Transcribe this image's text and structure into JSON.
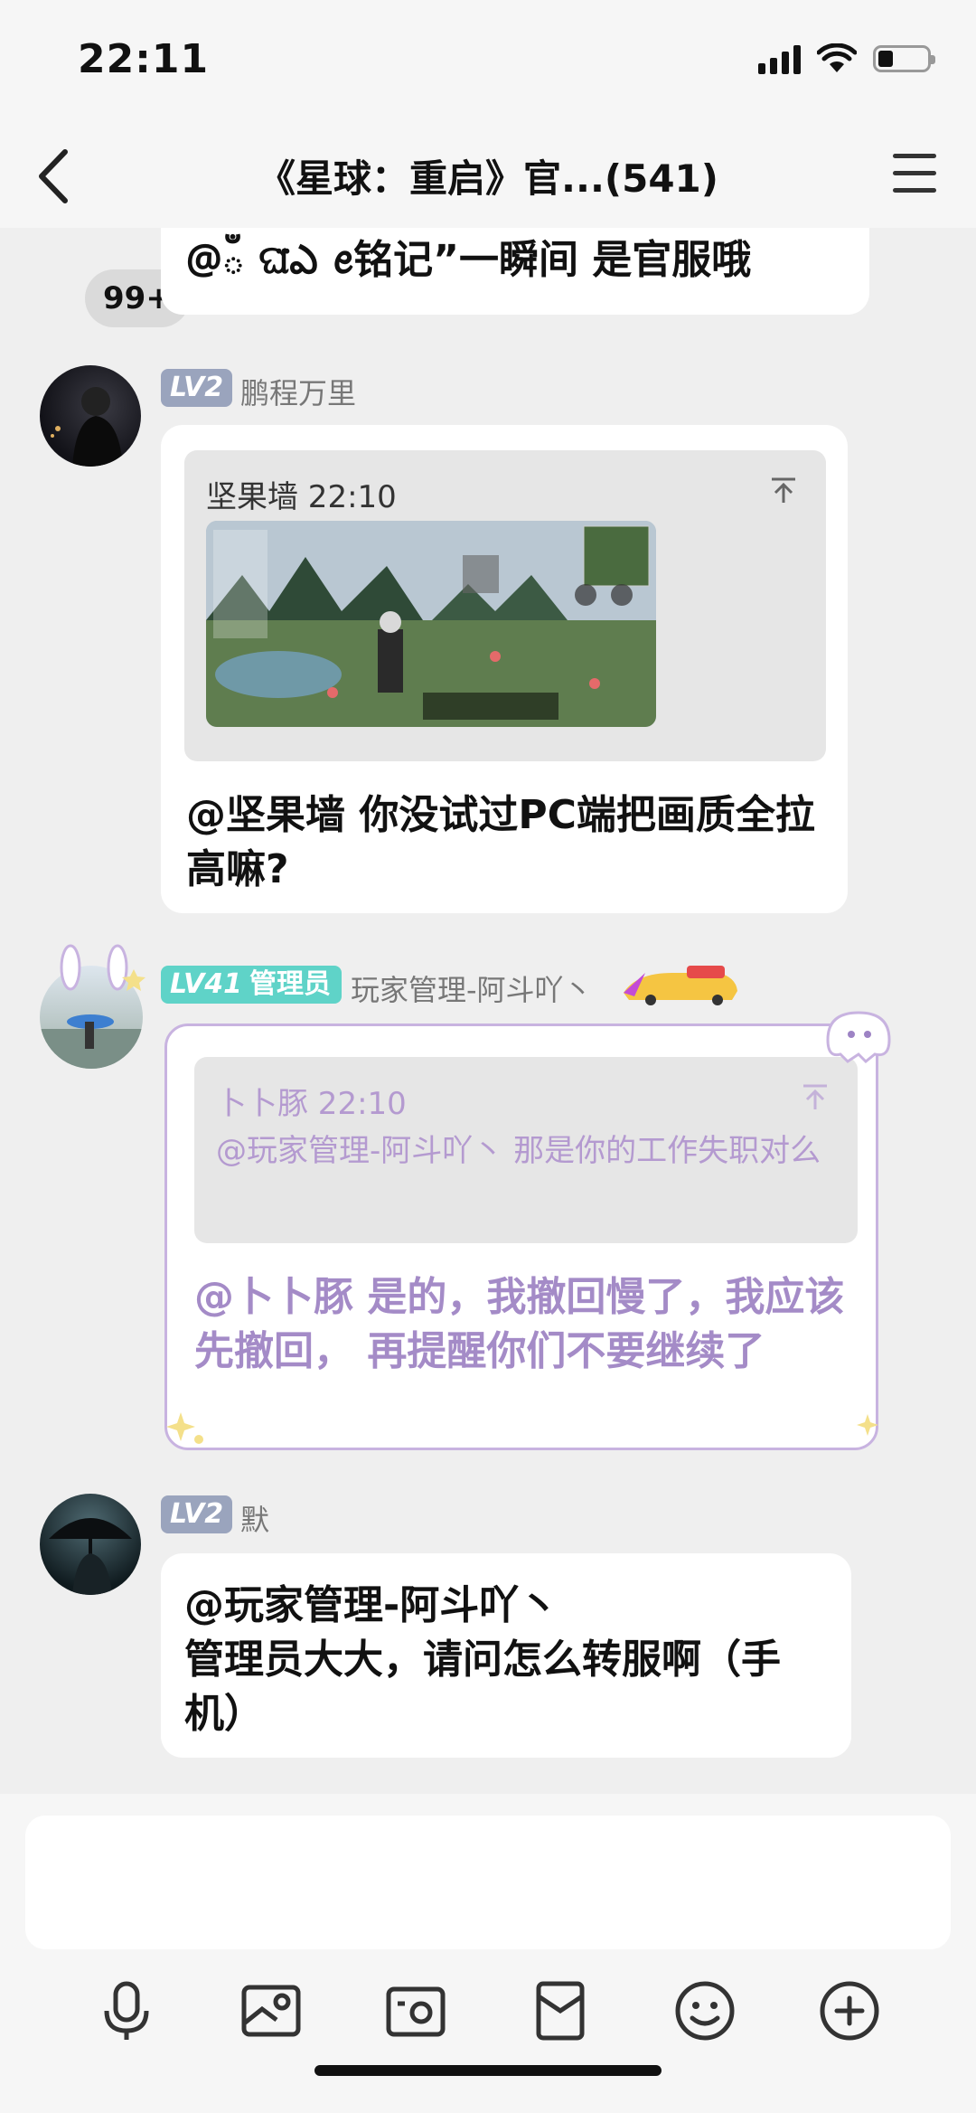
{
  "status": {
    "time": "22:11"
  },
  "nav": {
    "unread_badge": "99+",
    "title": "《星球：重启》官...(541)"
  },
  "messages": [
    {
      "text": "@ఀ ଘ̈ఎ ꫀ铭记”一瞬间 是官服哦"
    },
    {
      "level": "LV2",
      "name": "鹏程万里",
      "quote": {
        "header": "坚果墙 22:10"
      },
      "text": "@坚果墙 你没试过PC端把画质全拉高嘛?"
    },
    {
      "level": "LV41",
      "role": "管理员",
      "name": "玩家管理-阿斗吖丶",
      "quote": {
        "header": "卜卜豚 22:10",
        "body": "@玩家管理-阿斗吖丶 那是你的工作失职对么"
      },
      "text": "@卜卜豚  是的，我撤回慢了，我应该先撤回， 再提醒你们不要继续了"
    },
    {
      "level": "LV2",
      "name": "默",
      "text_line1": "@玩家管理-阿斗吖丶",
      "text_line2": "管理员大大，请问怎么转服啊（手机）"
    }
  ],
  "input": {
    "placeholder": ""
  },
  "toolbar": [
    "microphone-icon",
    "photo-icon",
    "camera-icon",
    "red-packet-icon",
    "emoji-icon",
    "plus-icon"
  ],
  "colors": {
    "lv_badge": "#9aa4bd",
    "lv41_badge": "#5fd3c8",
    "admin_text": "#a48bc7",
    "admin_border": "#c8b3e0"
  }
}
